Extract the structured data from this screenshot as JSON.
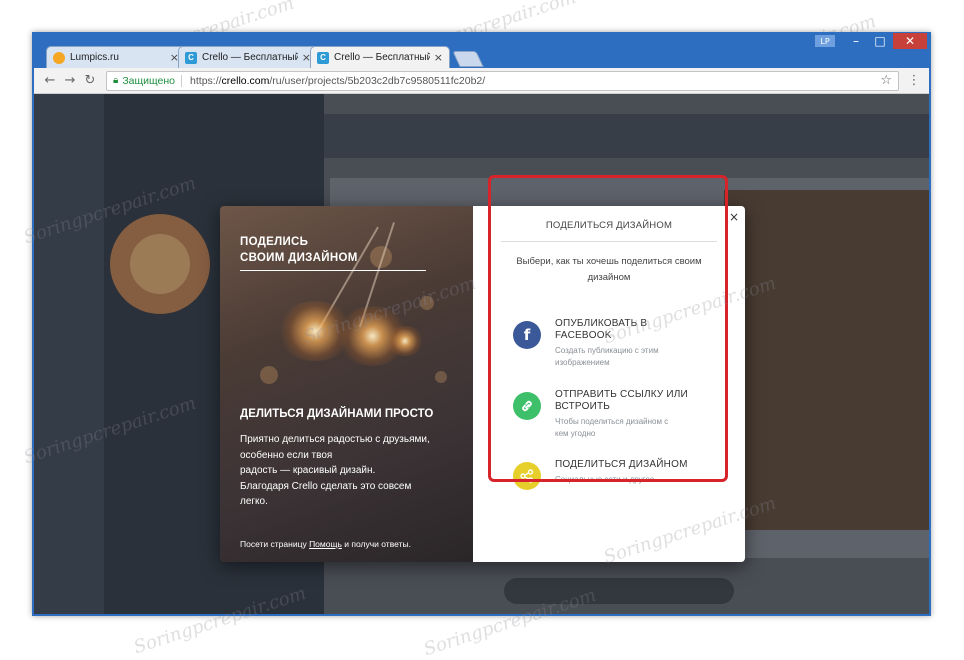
{
  "window": {
    "profile_label": "LP",
    "minimize": "–",
    "maximize": "□",
    "close": "✕"
  },
  "tabs": [
    {
      "label": "Lumpics.ru",
      "favicon": "orange-circle-icon"
    },
    {
      "label": "Crello — Бесплатный ин",
      "favicon": "crello-icon"
    },
    {
      "label": "Crello — Бесплатный ин",
      "favicon": "crello-icon",
      "active": true
    }
  ],
  "toolbar": {
    "back": "←",
    "forward": "→",
    "reload": "↻",
    "secure_label": "Защищено",
    "url_scheme": "https://",
    "url_host": "crello.com",
    "url_path": "/ru/user/projects/5b203c2db7c9580511fc20b2/",
    "star": "☆",
    "menu": "⋮"
  },
  "modal": {
    "left": {
      "heading_line1": "ПОДЕЛИСЬ",
      "heading_line2": "СВОИМ ДИЗАЙНОМ",
      "title": "ДЕЛИТЬСЯ ДИЗАЙНАМИ ПРОСТО",
      "body_lines": [
        "Приятно делиться радостью с друзьями,",
        "особенно если твоя",
        "радость — красивый дизайн.",
        "Благодаря Crello сделать это совсем",
        "легко."
      ],
      "footer_pre": "Посети страницу ",
      "footer_link": "Помощь",
      "footer_post": " и получи ответы."
    },
    "right": {
      "close": "×",
      "title": "ПОДЕЛИТЬСЯ ДИЗАЙНОМ",
      "subtitle_line1": "Выбери, как ты хочешь поделиться своим",
      "subtitle_line2": "дизайном",
      "options": [
        {
          "title_line1": "ОПУБЛИКОВАТЬ В",
          "title_line2": "FACEBOOK",
          "desc_line1": "Создать публикацию с этим",
          "desc_line2": "изображением",
          "icon": "facebook-icon",
          "icon_glyph": "f",
          "color": "#3b5998"
        },
        {
          "title_line1": "ОТПРАВИТЬ ССЫЛКУ ИЛИ",
          "title_line2": "ВСТРОИТЬ",
          "desc_line1": "Чтобы поделиться дизайном с",
          "desc_line2": "кем угодно",
          "icon": "link-icon",
          "color": "#3ebf6a"
        },
        {
          "title_line1": "ПОДЕЛИТЬСЯ ДИЗАЙНОМ",
          "title_line2": "",
          "desc_line1": "Социальные сети и другое",
          "desc_line2": "",
          "icon": "share-icon",
          "color": "#e6cf2a"
        }
      ]
    }
  },
  "watermark": "Soringpcrepair.com"
}
